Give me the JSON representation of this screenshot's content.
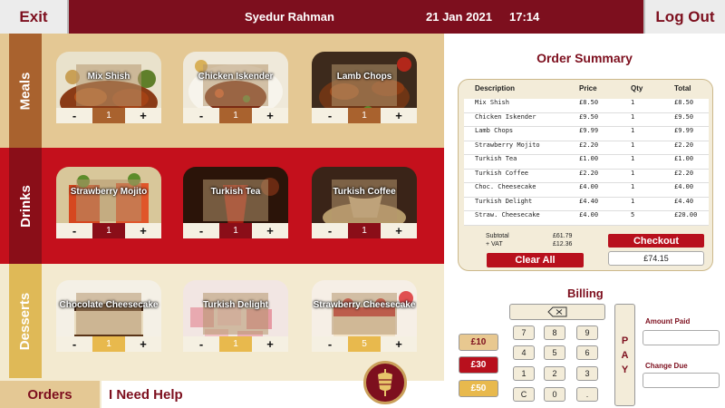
{
  "topbar": {
    "exit_label": "Exit",
    "user_name": "Syedur Rahman",
    "date": "21 Jan 2021",
    "time": "17:14",
    "logout_label": "Log Out"
  },
  "menu": {
    "sections": [
      {
        "label": "Meals",
        "items": [
          {
            "name": "Mix Shish",
            "qty": "1"
          },
          {
            "name": "Chicken Iskender",
            "qty": "1"
          },
          {
            "name": "Lamb Chops",
            "qty": "1"
          }
        ]
      },
      {
        "label": "Drinks",
        "items": [
          {
            "name": "Strawberry Mojito",
            "qty": "1"
          },
          {
            "name": "Turkish Tea",
            "qty": "1"
          },
          {
            "name": "Turkish Coffee",
            "qty": "1"
          }
        ]
      },
      {
        "label": "Desserts",
        "items": [
          {
            "name": "Chocolate Cheesecake",
            "qty": "1"
          },
          {
            "name": "Turkish Delight",
            "qty": "1"
          },
          {
            "name": "Strawberry Cheesecake",
            "qty": "5"
          }
        ]
      }
    ],
    "minus": "-",
    "plus": "+"
  },
  "bottom": {
    "orders_label": "Orders",
    "help_label": "I Need Help"
  },
  "order_summary": {
    "title": "Order Summary",
    "headers": {
      "desc": "Description",
      "price": "Price",
      "qty": "Qty",
      "total": "Total"
    },
    "rows": [
      {
        "desc": "Mix Shish",
        "price": "£8.50",
        "qty": "1",
        "total": "£8.50"
      },
      {
        "desc": "Chicken Iskender",
        "price": "£9.50",
        "qty": "1",
        "total": "£9.50"
      },
      {
        "desc": "Lamb Chops",
        "price": "£9.99",
        "qty": "1",
        "total": "£9.99"
      },
      {
        "desc": "Strawberry Mojito",
        "price": "£2.20",
        "qty": "1",
        "total": "£2.20"
      },
      {
        "desc": "Turkish Tea",
        "price": "£1.00",
        "qty": "1",
        "total": "£1.00"
      },
      {
        "desc": "Turkish Coffee",
        "price": "£2.20",
        "qty": "1",
        "total": "£2.20"
      },
      {
        "desc": "Choc. Cheesecake",
        "price": "£4.00",
        "qty": "1",
        "total": "£4.00"
      },
      {
        "desc": "Turkish Delight",
        "price": "£4.40",
        "qty": "1",
        "total": "£4.40"
      },
      {
        "desc": "Straw. Cheesecake",
        "price": "£4.00",
        "qty": "5",
        "total": "£20.00"
      }
    ],
    "subtotal_label": "Subtotal",
    "subtotal_value": "£61.79",
    "vat_label": "+ VAT",
    "vat_value": "£12.36",
    "checkout_label": "Checkout",
    "total_value": "£74.15",
    "clear_label": "Clear All"
  },
  "billing": {
    "title": "Billing",
    "keys": [
      "7",
      "8",
      "9",
      "4",
      "5",
      "6",
      "1",
      "2",
      "3",
      "C",
      "0",
      "."
    ],
    "cash_buttons": [
      "£10",
      "£30",
      "£50"
    ],
    "pay_letters": [
      "P",
      "A",
      "Y"
    ],
    "amount_paid_label": "Amount Paid",
    "change_due_label": "Change Due",
    "amount_paid_value": "",
    "change_due_value": ""
  },
  "colors": {
    "brand": "#7d0f1e",
    "accent_red": "#b8101d",
    "meals_bg": "#e4c894",
    "drinks_bg": "#c4101c",
    "desserts_bg": "#f3ead0"
  }
}
